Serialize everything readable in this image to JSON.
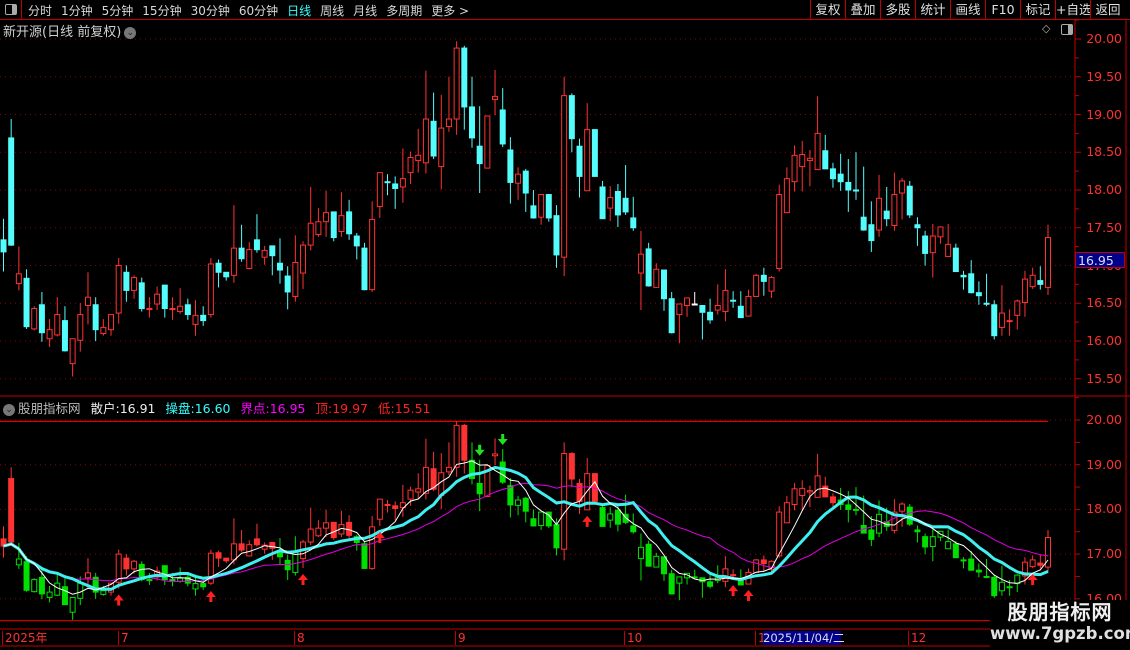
{
  "toolbar": {
    "periods": [
      "分时",
      "1分钟",
      "5分钟",
      "15分钟",
      "30分钟",
      "60分钟",
      "日线",
      "周线",
      "月线",
      "多周期",
      "更多 >"
    ],
    "active_period": "日线",
    "right_buttons": [
      "复权",
      "叠加",
      "多股",
      "统计",
      "画线",
      "F10",
      "标记",
      "+自选",
      "返回"
    ]
  },
  "main": {
    "title": "新开源(日线 前复权)",
    "y_ticks": [
      "20.00",
      "19.50",
      "19.00",
      "18.50",
      "18.00",
      "17.50",
      "17.00",
      "16.50",
      "16.00",
      "15.50"
    ],
    "current_marker": "16.95"
  },
  "indicator": {
    "name": "股朋指标网",
    "sanhu_label": "散户:",
    "sanhu_value": "16.91",
    "caopan_label": "操盘:",
    "caopan_value": "16.60",
    "jiedian_label": "界点:",
    "jiedian_value": "16.95",
    "top_label": "顶:",
    "top_value": "19.97",
    "low_label": "低:",
    "low_value": "15.51",
    "y_ticks": [
      "20.00",
      "19.00",
      "18.00",
      "17.00",
      "16.00"
    ]
  },
  "x_axis": {
    "labels": [
      "2025年",
      "7",
      "8",
      "9",
      "10",
      "1",
      "12"
    ],
    "cursor_date": "2025/11/04/二"
  },
  "watermark": {
    "cn": "股朋指标网",
    "url": "www.7gpzb.com"
  },
  "chart_data": {
    "type": "candlestick",
    "columns": [
      "open",
      "high",
      "low",
      "close"
    ],
    "ohlc": [
      [
        17.34,
        17.62,
        16.92,
        17.18
      ],
      [
        18.69,
        18.94,
        17.26,
        17.27
      ],
      [
        16.76,
        17.25,
        16.67,
        16.89
      ],
      [
        16.83,
        16.95,
        16.16,
        16.19
      ],
      [
        16.16,
        16.46,
        16.14,
        16.43
      ],
      [
        16.48,
        16.65,
        15.99,
        16.11
      ],
      [
        16.03,
        16.29,
        15.92,
        16.15
      ],
      [
        16.08,
        16.58,
        16.06,
        16.35
      ],
      [
        16.27,
        16.46,
        15.86,
        15.87
      ],
      [
        15.7,
        16.03,
        15.53,
        16.03
      ],
      [
        16.01,
        16.5,
        15.86,
        16.35
      ],
      [
        16.47,
        16.91,
        16.22,
        16.58
      ],
      [
        16.48,
        16.58,
        16.0,
        16.15
      ],
      [
        16.1,
        16.29,
        16.07,
        16.18
      ],
      [
        16.15,
        16.35,
        16.07,
        16.35
      ],
      [
        16.37,
        17.1,
        16.23,
        17.0
      ],
      [
        16.91,
        17.0,
        16.52,
        16.67
      ],
      [
        16.67,
        16.87,
        16.56,
        16.84
      ],
      [
        16.77,
        16.84,
        16.39,
        16.43
      ],
      [
        16.42,
        16.58,
        16.31,
        16.43
      ],
      [
        16.49,
        16.72,
        16.41,
        16.62
      ],
      [
        16.74,
        16.74,
        16.31,
        16.43
      ],
      [
        16.42,
        16.58,
        16.28,
        16.43
      ],
      [
        16.39,
        16.7,
        16.36,
        16.46
      ],
      [
        16.48,
        16.56,
        16.28,
        16.35
      ],
      [
        16.22,
        16.54,
        16.07,
        16.34
      ],
      [
        16.34,
        16.46,
        16.2,
        16.27
      ],
      [
        16.35,
        17.1,
        16.31,
        17.02
      ],
      [
        17.03,
        17.08,
        16.71,
        16.91
      ],
      [
        16.91,
        16.91,
        16.8,
        16.85
      ],
      [
        16.87,
        17.8,
        16.77,
        17.23
      ],
      [
        17.23,
        17.54,
        17.05,
        17.09
      ],
      [
        16.96,
        17.31,
        16.95,
        17.21
      ],
      [
        17.34,
        17.68,
        17.17,
        17.21
      ],
      [
        17.11,
        17.26,
        17.01,
        17.2
      ],
      [
        17.26,
        17.26,
        16.87,
        17.13
      ],
      [
        17.03,
        17.36,
        16.76,
        16.94
      ],
      [
        16.86,
        16.99,
        16.42,
        16.65
      ],
      [
        16.59,
        17.4,
        16.52,
        17.04
      ],
      [
        16.9,
        17.32,
        16.69,
        17.27
      ],
      [
        17.27,
        18.04,
        17.2,
        17.56
      ],
      [
        17.41,
        17.76,
        17.38,
        17.58
      ],
      [
        17.58,
        17.99,
        17.38,
        17.7
      ],
      [
        17.71,
        17.71,
        17.32,
        17.37
      ],
      [
        17.45,
        17.97,
        17.38,
        17.66
      ],
      [
        17.71,
        17.87,
        17.34,
        17.42
      ],
      [
        17.39,
        17.43,
        17.08,
        17.26
      ],
      [
        17.23,
        17.3,
        16.67,
        16.68
      ],
      [
        16.68,
        17.85,
        16.65,
        17.61
      ],
      [
        17.78,
        18.23,
        17.63,
        18.23
      ],
      [
        18.11,
        18.21,
        17.93,
        18.1
      ],
      [
        18.08,
        18.18,
        17.75,
        18.02
      ],
      [
        18.04,
        18.55,
        17.83,
        18.15
      ],
      [
        18.23,
        18.51,
        18.08,
        18.43
      ],
      [
        18.39,
        18.81,
        18.23,
        18.46
      ],
      [
        18.36,
        19.58,
        18.22,
        18.94
      ],
      [
        18.91,
        19.29,
        18.41,
        18.45
      ],
      [
        18.31,
        19.26,
        18.01,
        18.82
      ],
      [
        18.84,
        19.5,
        18.77,
        18.94
      ],
      [
        18.94,
        19.97,
        18.73,
        19.88
      ],
      [
        19.88,
        19.91,
        18.8,
        19.1
      ],
      [
        19.1,
        19.5,
        18.56,
        18.69
      ],
      [
        18.58,
        19.11,
        17.96,
        18.35
      ],
      [
        18.29,
        18.98,
        18.29,
        18.98
      ],
      [
        19.2,
        19.59,
        18.99,
        19.24
      ],
      [
        19.06,
        19.35,
        18.57,
        18.61
      ],
      [
        18.53,
        18.7,
        17.82,
        18.1
      ],
      [
        18.09,
        18.3,
        17.87,
        18.21
      ],
      [
        18.25,
        18.28,
        17.71,
        17.96
      ],
      [
        17.79,
        18.0,
        17.62,
        17.63
      ],
      [
        17.64,
        17.94,
        17.54,
        17.94
      ],
      [
        17.94,
        17.94,
        17.58,
        17.63
      ],
      [
        17.66,
        17.8,
        16.97,
        17.14
      ],
      [
        17.11,
        19.5,
        16.86,
        19.25
      ],
      [
        19.25,
        19.28,
        18.5,
        18.68
      ],
      [
        18.58,
        18.68,
        17.9,
        18.18
      ],
      [
        17.99,
        19.15,
        17.99,
        18.8
      ],
      [
        18.8,
        18.8,
        18.18,
        18.18
      ],
      [
        18.04,
        18.12,
        17.62,
        17.62
      ],
      [
        17.76,
        18.05,
        17.59,
        17.9
      ],
      [
        17.98,
        18.08,
        17.51,
        17.67
      ],
      [
        17.89,
        18.33,
        17.67,
        17.71
      ],
      [
        17.63,
        17.91,
        17.46,
        17.5
      ],
      [
        16.9,
        17.46,
        16.41,
        17.15
      ],
      [
        17.22,
        17.3,
        16.72,
        16.73
      ],
      [
        16.71,
        17.03,
        16.71,
        16.95
      ],
      [
        16.94,
        16.94,
        16.4,
        16.56
      ],
      [
        16.56,
        16.65,
        16.1,
        16.11
      ],
      [
        16.35,
        16.49,
        15.97,
        16.49
      ],
      [
        16.47,
        16.57,
        16.32,
        16.57
      ],
      [
        16.49,
        16.65,
        16.49,
        16.49
      ],
      [
        16.47,
        16.47,
        16.02,
        16.38
      ],
      [
        16.38,
        16.56,
        16.23,
        16.28
      ],
      [
        16.41,
        16.75,
        16.35,
        16.47
      ],
      [
        16.39,
        16.95,
        16.26,
        16.67
      ],
      [
        16.54,
        16.66,
        16.44,
        16.53
      ],
      [
        16.46,
        16.66,
        16.31,
        16.31
      ],
      [
        16.33,
        16.68,
        16.33,
        16.59
      ],
      [
        16.59,
        16.89,
        16.59,
        16.87
      ],
      [
        16.87,
        16.97,
        16.6,
        16.79
      ],
      [
        16.66,
        16.86,
        16.57,
        16.84
      ],
      [
        16.96,
        18.07,
        16.92,
        17.94
      ],
      [
        17.7,
        18.3,
        17.7,
        18.15
      ],
      [
        18.11,
        18.59,
        17.98,
        18.46
      ],
      [
        18.31,
        18.65,
        17.98,
        18.47
      ],
      [
        18.39,
        18.53,
        18.05,
        18.42
      ],
      [
        18.27,
        19.24,
        18.27,
        18.75
      ],
      [
        18.52,
        18.73,
        18.28,
        18.28
      ],
      [
        18.28,
        18.36,
        18.03,
        18.15
      ],
      [
        18.21,
        18.48,
        17.99,
        18.11
      ],
      [
        18.1,
        18.41,
        17.71,
        18.0
      ],
      [
        18.0,
        18.5,
        17.87,
        17.99
      ],
      [
        17.64,
        18.31,
        17.46,
        17.47
      ],
      [
        17.54,
        17.85,
        17.18,
        17.33
      ],
      [
        17.47,
        18.2,
        17.38,
        17.89
      ],
      [
        17.72,
        18.04,
        17.52,
        17.62
      ],
      [
        17.53,
        18.23,
        17.46,
        17.94
      ],
      [
        17.96,
        18.16,
        17.61,
        18.12
      ],
      [
        18.05,
        18.12,
        17.63,
        17.67
      ],
      [
        17.54,
        17.64,
        17.26,
        17.5
      ],
      [
        17.39,
        17.46,
        17.0,
        17.16
      ],
      [
        17.17,
        17.55,
        16.84,
        17.39
      ],
      [
        17.38,
        17.52,
        17.29,
        17.51
      ],
      [
        17.12,
        17.55,
        17.12,
        17.28
      ],
      [
        17.23,
        17.29,
        16.92,
        16.92
      ],
      [
        16.87,
        16.93,
        16.68,
        16.85
      ],
      [
        16.89,
        17.07,
        16.63,
        16.64
      ],
      [
        16.64,
        16.79,
        16.48,
        16.6
      ],
      [
        16.5,
        16.89,
        16.46,
        16.49
      ],
      [
        16.48,
        16.54,
        16.02,
        16.07
      ],
      [
        16.18,
        16.74,
        16.07,
        16.37
      ],
      [
        16.26,
        16.42,
        16.07,
        16.27
      ],
      [
        16.34,
        16.55,
        16.15,
        16.53
      ],
      [
        16.51,
        16.93,
        16.32,
        16.82
      ],
      [
        16.72,
        16.97,
        16.69,
        16.87
      ],
      [
        16.8,
        16.99,
        16.68,
        16.75
      ],
      [
        16.71,
        17.54,
        16.61,
        17.37
      ]
    ],
    "main_ylim": [
      15.5,
      20.0
    ],
    "indicator_ylim": [
      16.0,
      20.0
    ],
    "indicator_lines": [
      {
        "name": "散户",
        "period": 5,
        "color": "#ffffff"
      },
      {
        "name": "操盘",
        "period": 10,
        "color": "#40f0f0"
      },
      {
        "name": "界点",
        "period": 20,
        "color": "#e000e0"
      }
    ],
    "top": 19.97,
    "low": 15.51,
    "buy_signal_indices": [
      15,
      27,
      39,
      49,
      76,
      95,
      97,
      134
    ],
    "sell_signal_indices": [
      62,
      65
    ],
    "grid": true,
    "colors": {
      "up": "#ff3232",
      "down_main": "#54fcfc",
      "down_indicator": "#00e000",
      "axis": "#c00000",
      "grid": "#8b0000"
    }
  }
}
